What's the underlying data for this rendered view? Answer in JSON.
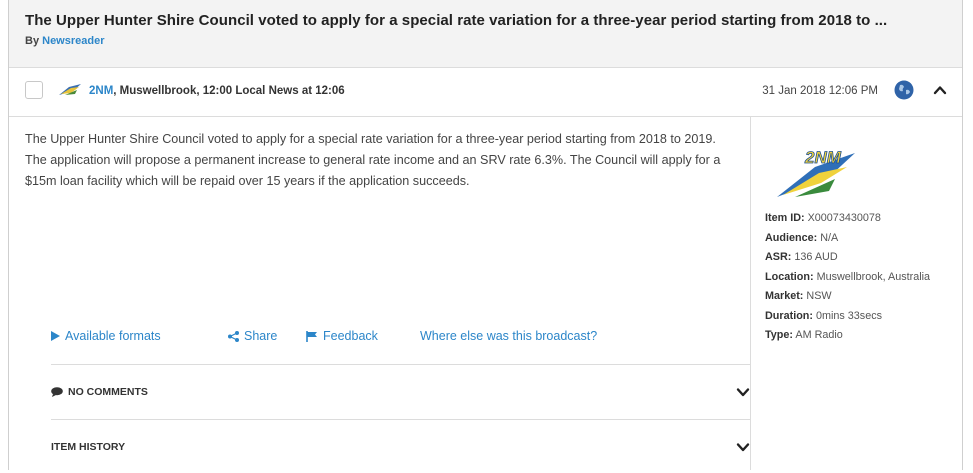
{
  "header": {
    "title": "The Upper Hunter Shire Council voted to apply for a special rate variation for a three-year period starting from 2018 to ...",
    "by_prefix": "By",
    "author": "Newsreader"
  },
  "item": {
    "station": "2NM",
    "source_rest": ", Muswellbrook, 12:00 Local News at 12:06",
    "datetime": "31 Jan 2018 12:06 PM",
    "icons": {
      "source": "radio-source-icon",
      "globe": "globe-icon",
      "collapse": "chevron-up-icon"
    }
  },
  "summary": "The Upper Hunter Shire Council voted to apply for a special rate variation for a three-year period starting from 2018 to 2019. The application will propose a permanent increase to general rate income and an SRV rate 6.3%. The Council will apply for a $15m loan facility which will be repaid over 15 years if the application succeeds.",
  "actions": {
    "formats": "Available formats",
    "share": "Share",
    "feedback": "Feedback",
    "broadcast": "Where else was this broadcast?"
  },
  "sections": {
    "comments": "NO COMMENTS",
    "history": "ITEM HISTORY"
  },
  "details": {
    "logo_text": "2NM",
    "item_id": {
      "label": "Item ID:",
      "value": "X00073430078"
    },
    "audience": {
      "label": "Audience:",
      "value": "N/A"
    },
    "asr": {
      "label": "ASR:",
      "value": "136 AUD"
    },
    "location": {
      "label": "Location:",
      "value": "Muswellbrook, Australia"
    },
    "market": {
      "label": "Market:",
      "value": "NSW"
    },
    "duration": {
      "label": "Duration:",
      "value": "0mins 33secs"
    },
    "type": {
      "label": "Type:",
      "value": "AM Radio"
    }
  },
  "colors": {
    "link": "#2c86c9",
    "header_bg": "#f3f3f3",
    "divider": "#dcdcdc"
  }
}
